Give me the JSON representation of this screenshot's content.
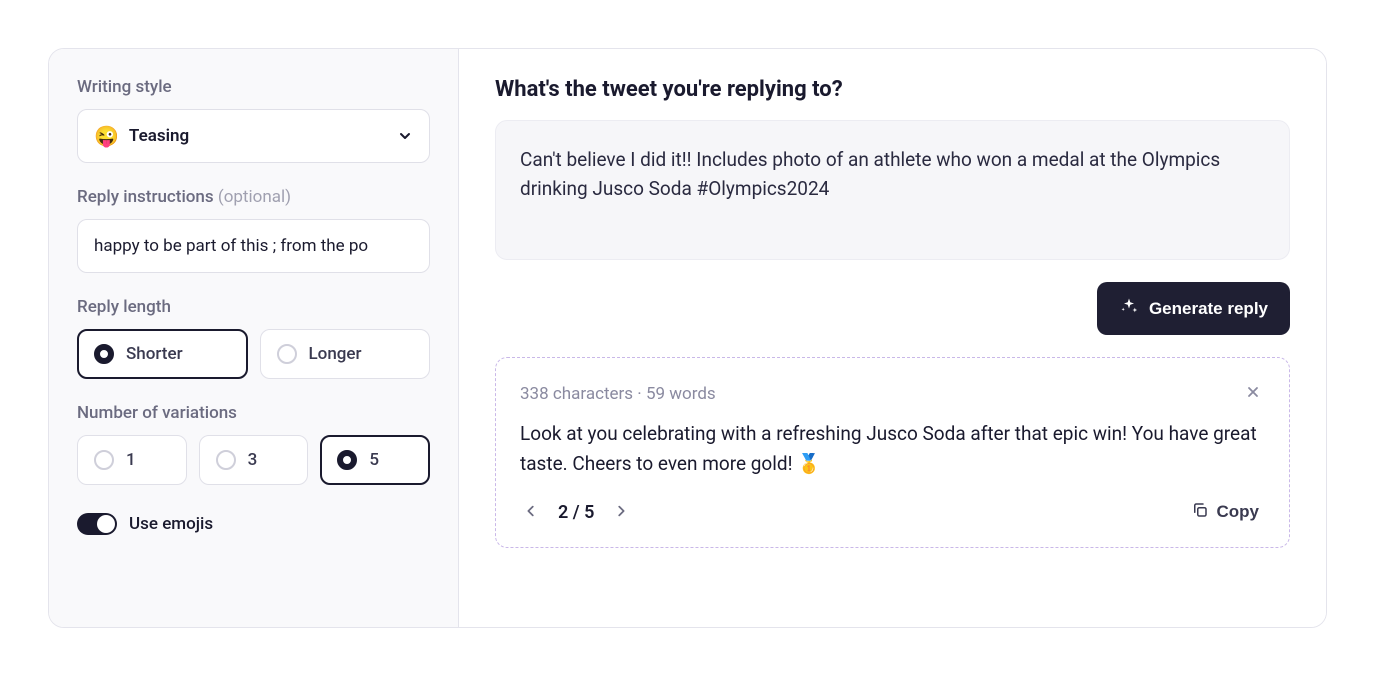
{
  "left": {
    "writing_style": {
      "label": "Writing style",
      "emoji": "😜",
      "selected": "Teasing"
    },
    "instructions": {
      "label": "Reply instructions ",
      "optional": "(optional)",
      "value": "happy to be part of this ; from the po"
    },
    "reply_length": {
      "label": "Reply length",
      "options": {
        "shorter": "Shorter",
        "longer": "Longer"
      },
      "selected": "shorter"
    },
    "variations": {
      "label": "Number of variations",
      "options": {
        "one": "1",
        "three": "3",
        "five": "5"
      },
      "selected": "five"
    },
    "emojis": {
      "label": "Use emojis",
      "enabled": true
    }
  },
  "right": {
    "question": "What's the tweet you're replying to?",
    "tweet_text": "Can't believe I did it!! Includes photo of an athlete who won a medal at the Olympics drinking Jusco Soda #Olympics2024",
    "generate_label": "Generate reply",
    "result": {
      "meta": "338 characters · 59 words",
      "body": "Look at you celebrating with a refreshing Jusco Soda after that epic win! You have great taste. Cheers to even more gold! 🥇",
      "pager": "2 / 5",
      "copy_label": "Copy"
    }
  }
}
